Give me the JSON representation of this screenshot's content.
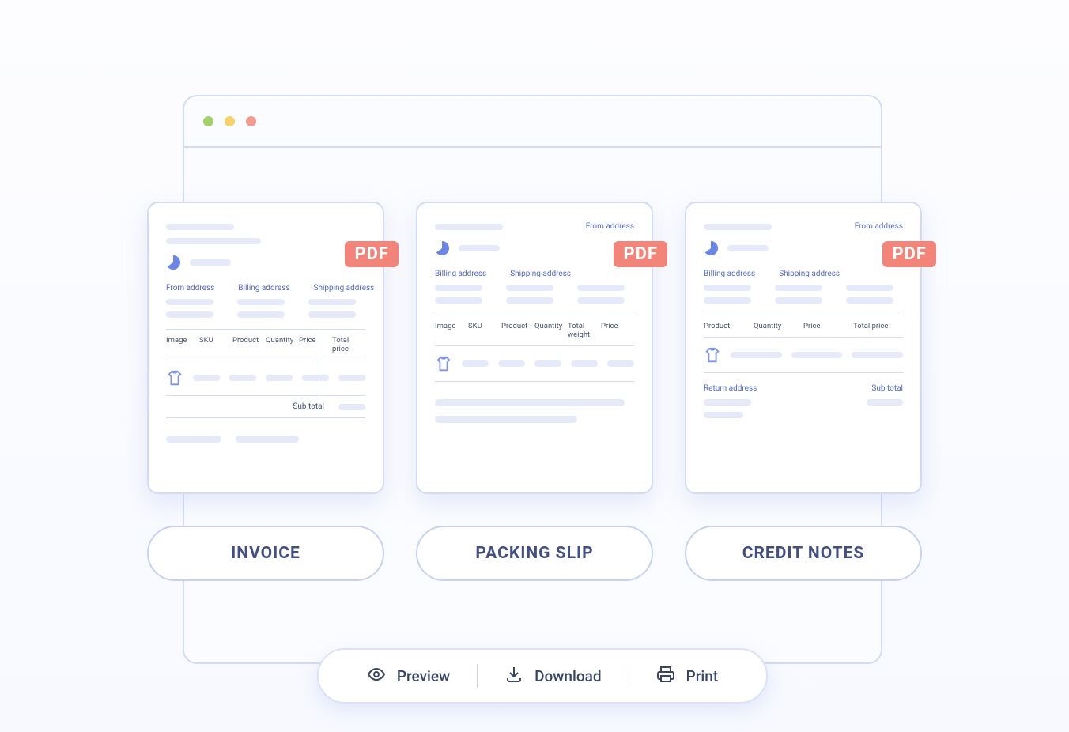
{
  "pdf_badge": "PDF",
  "cards": {
    "invoice": {
      "addr_labels": [
        "From address",
        "Billing address",
        "Shipping address"
      ],
      "columns": [
        "Image",
        "SKU",
        "Product",
        "Quantity",
        "Price",
        "Total price"
      ],
      "subtotal_label": "Sub total"
    },
    "packing_slip": {
      "top_right_label": "From address",
      "addr_labels": [
        "Billing address",
        "Shipping address"
      ],
      "columns": [
        "Image",
        "SKU",
        "Product",
        "Quantity",
        "Total weight",
        "Price"
      ]
    },
    "credit_notes": {
      "top_right_label": "From address",
      "addr_labels": [
        "Billing address",
        "Shipping address"
      ],
      "columns": [
        "Product",
        "Quantity",
        "Price",
        "Total price"
      ],
      "return_label": "Return address",
      "subtotal_label": "Sub total"
    }
  },
  "pills": {
    "invoice": "INVOICE",
    "packing_slip": "PACKING SLIP",
    "credit_notes": "CREDIT NOTES"
  },
  "actions": {
    "preview": "Preview",
    "download": "Download",
    "print": "Print"
  }
}
